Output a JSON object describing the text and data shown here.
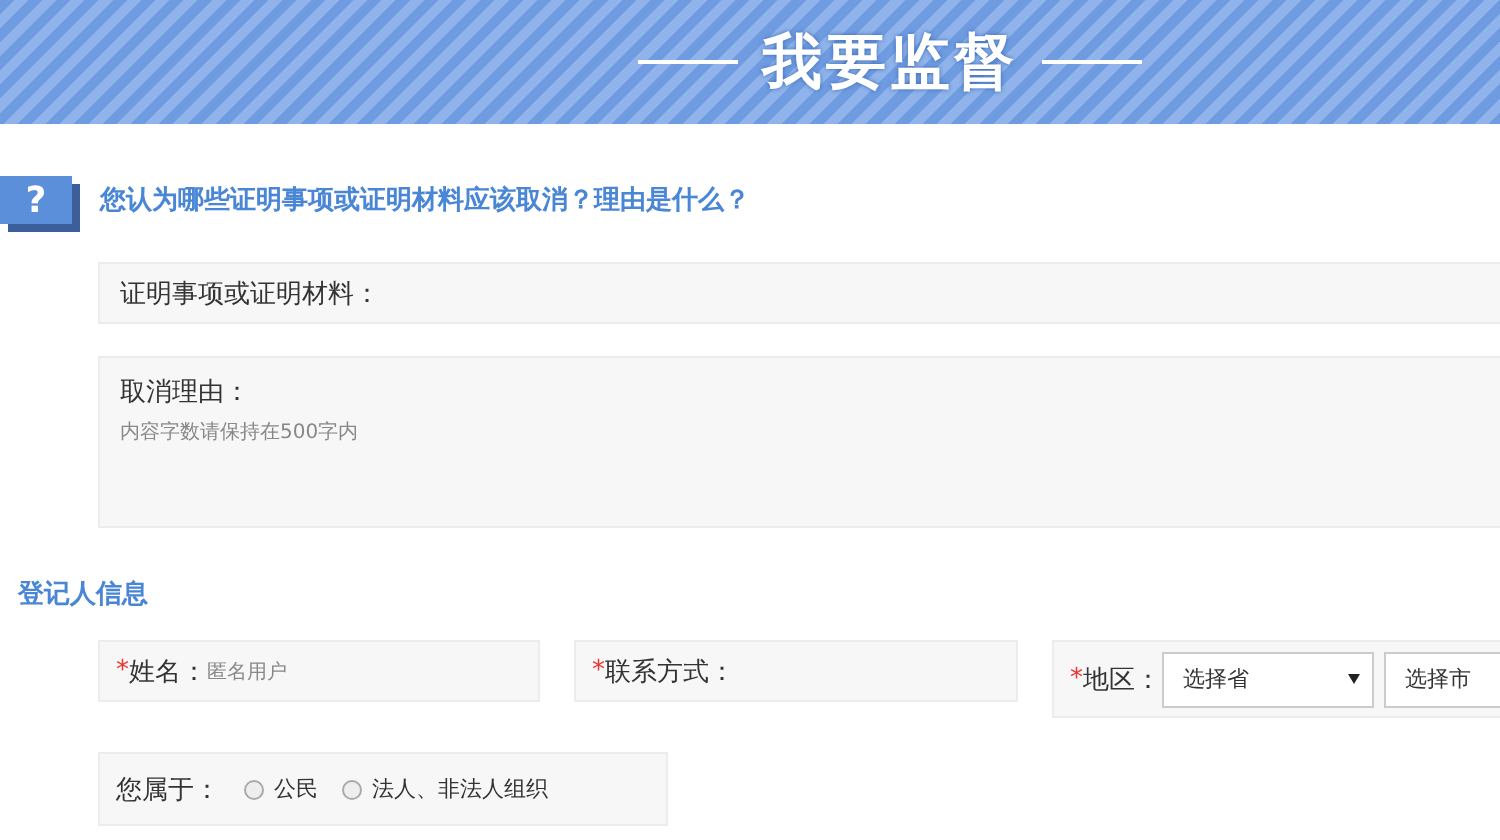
{
  "banner": {
    "title": "我要监督"
  },
  "question": {
    "icon": "?",
    "text": "您认为哪些证明事项或证明材料应该取消？理由是什么？"
  },
  "material_field": {
    "label": "证明事项或证明材料："
  },
  "reason_field": {
    "label": "取消理由：",
    "placeholder": "内容字数请保持在500字内"
  },
  "registrant": {
    "title": "登记人信息",
    "name": {
      "required_mark": "*",
      "label": "姓名：",
      "placeholder": "匿名用户"
    },
    "contact": {
      "required_mark": "*",
      "label": "联系方式："
    },
    "region": {
      "required_mark": "*",
      "label": "地区：",
      "province": "选择省",
      "city": "选择市"
    },
    "identity": {
      "label": "您属于：",
      "options": [
        {
          "label": "公民",
          "selected": false
        },
        {
          "label": "法人、非法人组织",
          "selected": false
        }
      ]
    }
  }
}
